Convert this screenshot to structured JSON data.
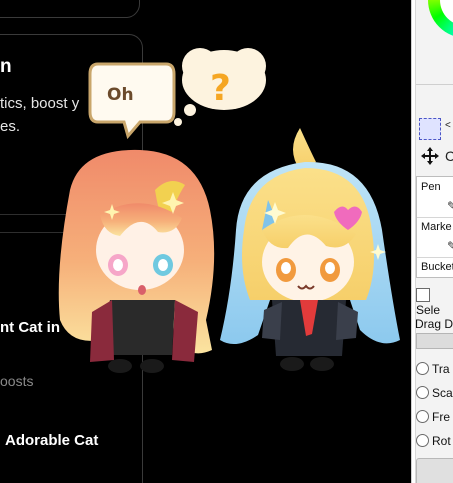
{
  "feed": {
    "card_title": "n",
    "card_desc_line1": "tics, boost y",
    "card_desc_line2": "es.",
    "post1_title_line1": "nt Cat in",
    "post1_title_line2": "",
    "post1_meta": "oosts",
    "post2_title": "Adorable Cat"
  },
  "toolbar": {
    "select_suffix": "<",
    "move_suffix": "C",
    "brushes": [
      "Pen",
      "Marke",
      "Bucket"
    ],
    "checkbox_label": "Sele",
    "drag_label": "Drag D",
    "radio_options": [
      "Tra",
      "Sca",
      "Fre",
      "Rot"
    ]
  },
  "speech": {
    "oh_text": "Oh",
    "thought_text": "?"
  },
  "colors": {
    "background": "#000000",
    "panel": "#f3f3f3",
    "thought_mark": "#f5a623",
    "oh_border": "#c9a66b",
    "oh_text": "#6b4a2b"
  },
  "icons": {
    "select": "dashed-rectangle-icon",
    "move": "four-arrow-move-icon"
  }
}
